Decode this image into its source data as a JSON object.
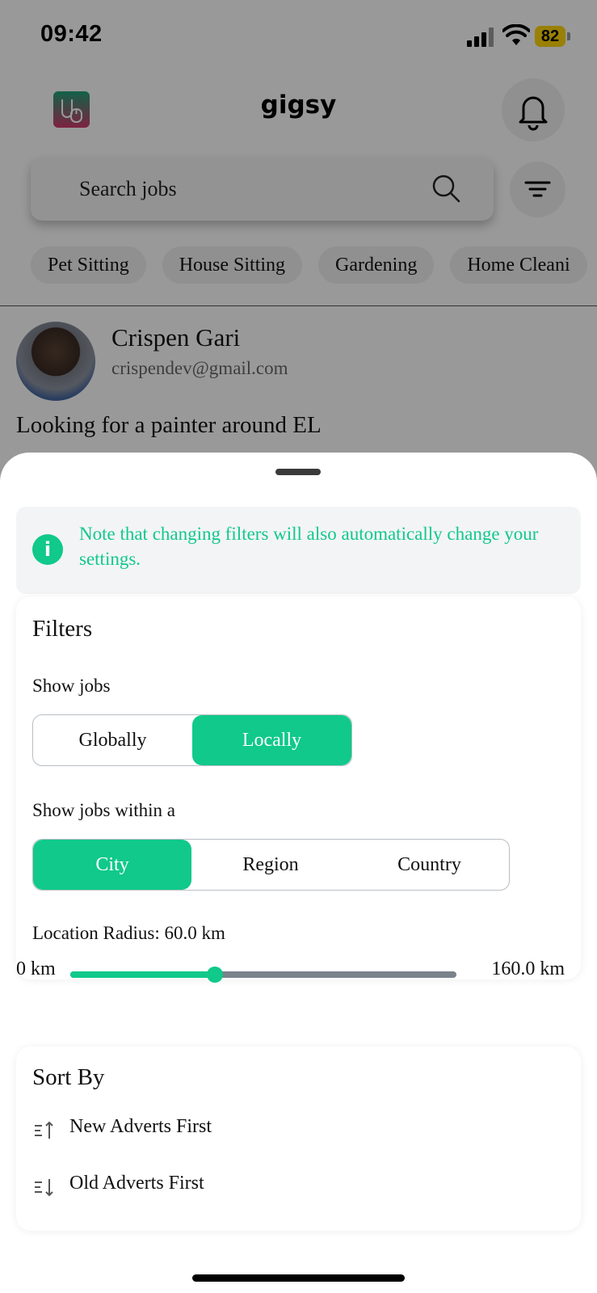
{
  "status_bar": {
    "time": "09:42",
    "battery": "82"
  },
  "header": {
    "title": "gigsy"
  },
  "search": {
    "placeholder": "Search jobs"
  },
  "categories": [
    "Pet Sitting",
    "House Sitting",
    "Gardening",
    "Home Cleani"
  ],
  "post": {
    "name": "Crispen Gari",
    "email": "crispendev@gmail.com",
    "text": "Looking for a painter around EL"
  },
  "sheet": {
    "note": "Note that changing filters will also automatically change your settings.",
    "filters": {
      "title": "Filters",
      "show_jobs_label": "Show jobs",
      "show_jobs_options": [
        "Globally",
        "Locally"
      ],
      "show_jobs_selected": "Locally",
      "within_label": "Show jobs within a",
      "within_options": [
        "City",
        "Region",
        "Country"
      ],
      "within_selected": "City",
      "radius_label": "Location Radius: 60.0 km",
      "radius_min_label": "0 km",
      "radius_max_label": "160.0 km",
      "radius_value": 60,
      "radius_max": 160
    },
    "sort": {
      "title": "Sort By",
      "options": [
        "New Adverts First",
        "Old Adverts First"
      ]
    }
  },
  "colors": {
    "accent": "#10c98a",
    "track": "#7a828c",
    "badge": "#ffd60a"
  }
}
